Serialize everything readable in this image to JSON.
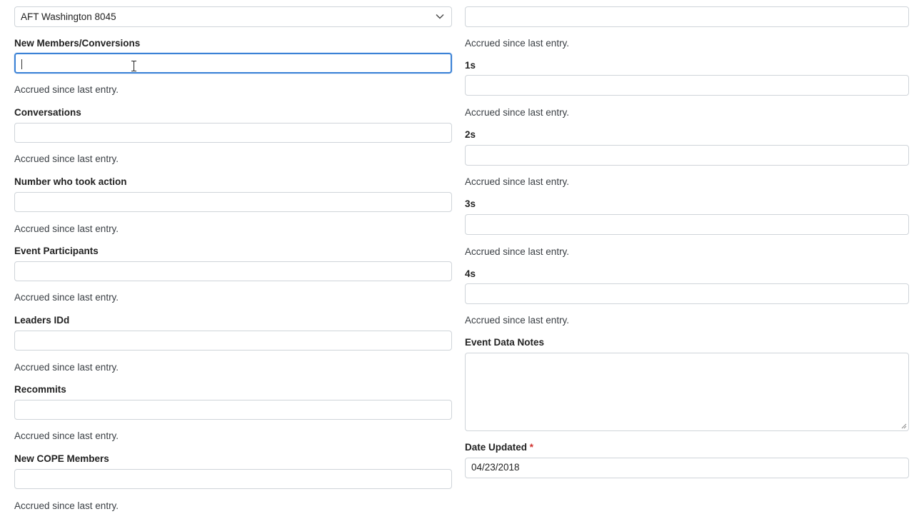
{
  "left": {
    "local_select": {
      "value": "AFT Washington 8045",
      "icon": "chevron-down-icon"
    },
    "fields": [
      {
        "label": "New Members/Conversions",
        "value": "",
        "help": "Accrued since last entry."
      },
      {
        "label": "Conversations",
        "value": "",
        "help": "Accrued since last entry."
      },
      {
        "label": "Number who took action",
        "value": "",
        "help": "Accrued since last entry."
      },
      {
        "label": "Event Participants",
        "value": "",
        "help": "Accrued since last entry."
      },
      {
        "label": "Leaders IDd",
        "value": "",
        "help": "Accrued since last entry."
      },
      {
        "label": "Recommits",
        "value": "",
        "help": "Accrued since last entry."
      },
      {
        "label": "New COPE Members",
        "value": "",
        "help": "Accrued since last entry."
      }
    ]
  },
  "right": {
    "top_field": {
      "value": "",
      "help": "Accrued since last entry."
    },
    "fields": [
      {
        "label": "1s",
        "value": "",
        "help": "Accrued since last entry."
      },
      {
        "label": "2s",
        "value": "",
        "help": "Accrued since last entry."
      },
      {
        "label": "3s",
        "value": "",
        "help": "Accrued since last entry."
      },
      {
        "label": "4s",
        "value": "",
        "help": "Accrued since last entry."
      }
    ],
    "notes": {
      "label": "Event Data Notes",
      "value": ""
    },
    "date_updated": {
      "label": "Date Updated",
      "required_mark": "*",
      "value": "04/23/2018"
    }
  },
  "colors": {
    "focus": "#3b82d6",
    "border": "#cfd4d9",
    "required": "#d0312d"
  }
}
